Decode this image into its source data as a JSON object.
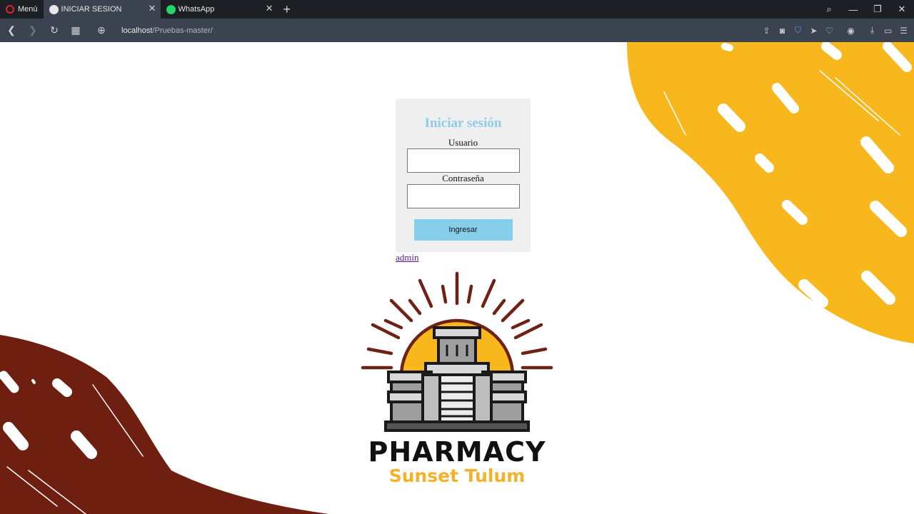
{
  "browser": {
    "menu_label": "Menú",
    "tabs": [
      {
        "title": "INICIAR SESION",
        "active": true
      },
      {
        "title": "WhatsApp",
        "active": false
      }
    ],
    "url_host": "localhost",
    "url_path": "/Pruebas-master/"
  },
  "login": {
    "title": "Iniciar sesión",
    "user_label": "Usuario",
    "password_label": "Contraseña",
    "user_value": "",
    "password_value": "",
    "submit_label": "Ingresar"
  },
  "admin_link": "admin",
  "brand": {
    "name": "PHARMACY",
    "tagline": "Sunset Tulum"
  },
  "colors": {
    "accent_blue": "#87ceeb",
    "title_blue": "#8ecde8",
    "yellow": "#f8b81d",
    "brown": "#6e1f10"
  }
}
